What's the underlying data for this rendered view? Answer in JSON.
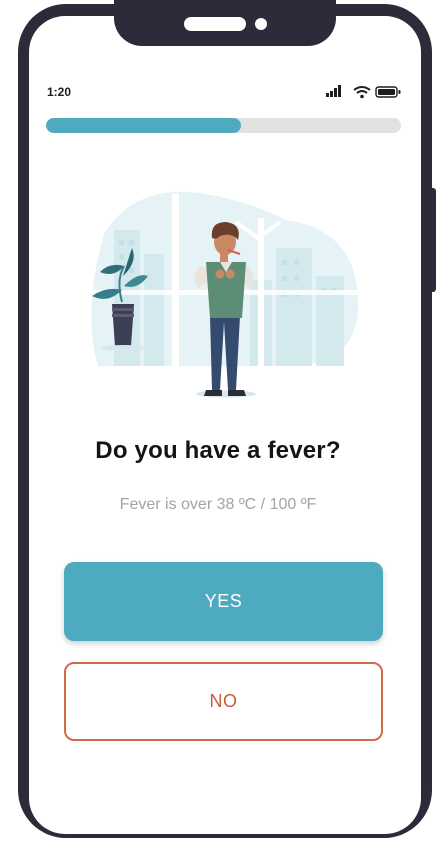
{
  "status_bar": {
    "time": "1:20",
    "icons": [
      "signal-icon",
      "wifi-icon",
      "battery-icon"
    ]
  },
  "progress": {
    "fraction": 0.55
  },
  "question": {
    "title": "Do you have a fever?",
    "hint": "Fever is over 38 ºC / 100 ºF"
  },
  "answers": {
    "yes_label": "YES",
    "no_label": "NO"
  },
  "colors": {
    "accent": "#4eaabe",
    "no_border": "#d46a4a",
    "no_text": "#c95b3b",
    "frame": "#2b2b3a"
  }
}
